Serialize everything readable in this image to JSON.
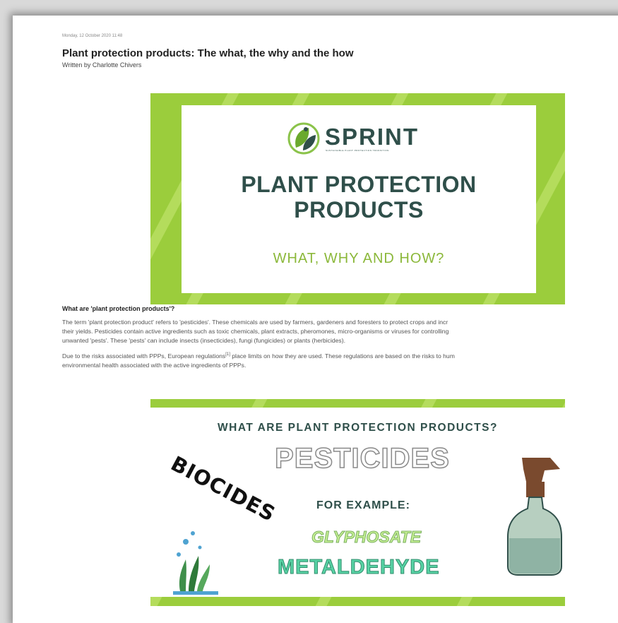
{
  "article": {
    "date": "Monday, 12 October 2020 11:48",
    "title": "Plant protection products: The what, the why and the how",
    "author": "Written by Charlotte Chivers"
  },
  "hero_image": {
    "logo_text": "SPRINT",
    "logo_tagline": "SUSTAINABLE PLANT PROTECTION TRANSITION",
    "heading": "PLANT PROTECTION PRODUCTS",
    "subheading": "WHAT, WHY AND HOW?"
  },
  "section": {
    "heading": "What are 'plant protection products'?",
    "p1_lines": [
      "The term 'plant protection product' refers to 'pesticides'. These chemicals are used by farmers, gardeners and foresters to protect crops and incr",
      "their yields. Pesticides contain active ingredients such as toxic chemicals, plant extracts, pheromones, micro-organisms or viruses for controlling",
      "unwanted 'pests'.  These 'pests' can include insects (insecticides), fungi (fungicides) or plants (herbicides)."
    ],
    "p2_before": "Due to the risks associated with PPPs, European regulations",
    "p2_ref": "[1]",
    "p2_after": " place limits on how they are used. These regulations are based on the risks to hum",
    "p2_line2": "environmental health associated with the active ingredients of PPPs."
  },
  "info_image": {
    "heading": "WHAT ARE PLANT PROTECTION PRODUCTS?",
    "pesticides": "PESTICIDES",
    "biocides": "BIOCIDES",
    "for_example": "FOR EXAMPLE:",
    "glyphosate": "GLYPHOSATE",
    "metaldehyde": "METALDEHYDE"
  },
  "colors": {
    "leaf_green": "#9bcd3c",
    "dark_teal": "#2f4f4a",
    "light_green_text": "#8bb83a"
  }
}
